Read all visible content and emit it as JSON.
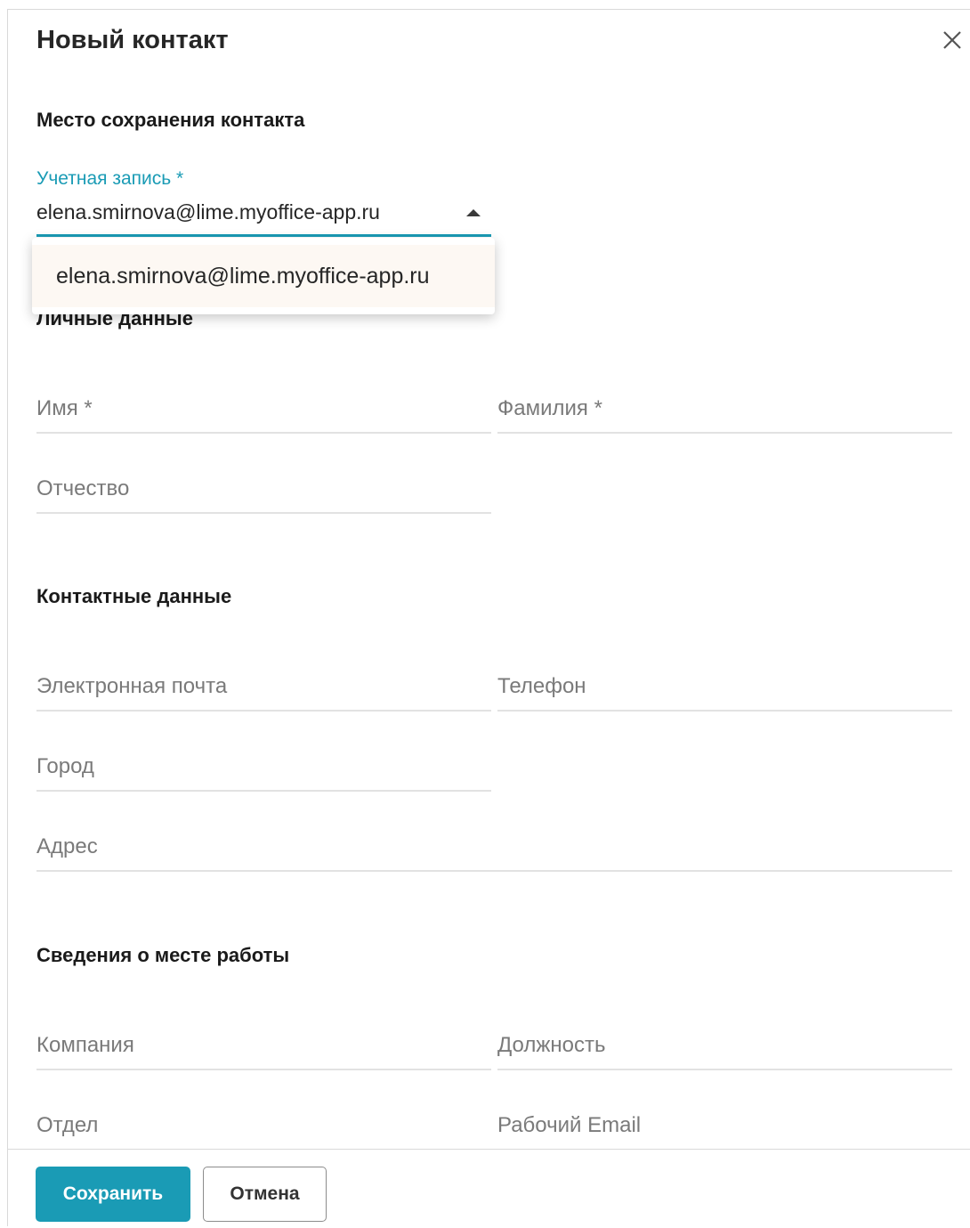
{
  "dialog": {
    "title": "Новый контакт"
  },
  "storage_section": {
    "title": "Место сохранения контакта",
    "account_label": "Учетная запись *",
    "account_value": "elena.smirnova@lime.myoffice-app.ru",
    "dropdown_options": [
      "elena.smirnova@lime.myoffice-app.ru"
    ]
  },
  "personal_section": {
    "title": "Личные данные",
    "first_name_placeholder": "Имя *",
    "last_name_placeholder": "Фамилия *",
    "middle_name_placeholder": "Отчество"
  },
  "contact_section": {
    "title": "Контактные данные",
    "email_placeholder": "Электронная почта",
    "phone_placeholder": "Телефон",
    "city_placeholder": "Город",
    "address_placeholder": "Адрес"
  },
  "work_section": {
    "title": "Сведения о месте работы",
    "company_placeholder": "Компания",
    "position_placeholder": "Должность",
    "department_placeholder": "Отдел",
    "work_email_placeholder": "Рабочий Email"
  },
  "footer": {
    "save_label": "Сохранить",
    "cancel_label": "Отмена"
  },
  "colors": {
    "accent": "#1a9bb5",
    "dropdown_highlight": "#fdf8f3",
    "field_underline": "#e2e2e2"
  },
  "icons": {
    "close": "close-icon",
    "dropdown_toggle": "caret-up-icon"
  }
}
